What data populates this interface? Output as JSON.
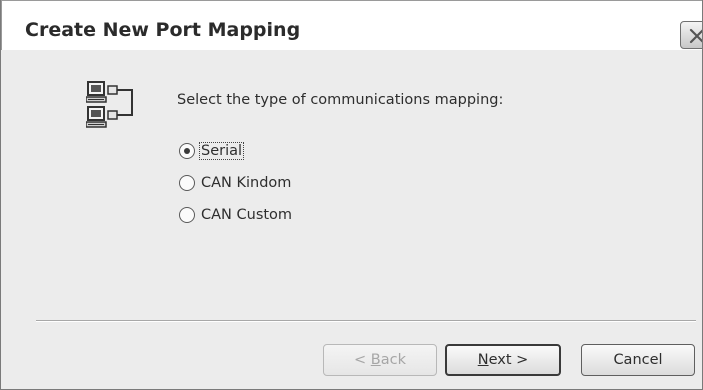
{
  "window": {
    "title": "Create New Port Mapping",
    "close_icon": "close-icon"
  },
  "content": {
    "icon": "network-mapping-icon",
    "prompt": "Select the type of communications mapping:",
    "options": [
      {
        "label": "Serial",
        "selected": true,
        "focused": true
      },
      {
        "label": "CAN Kindom",
        "selected": false,
        "focused": false
      },
      {
        "label": "CAN Custom",
        "selected": false,
        "focused": false
      }
    ]
  },
  "buttons": {
    "back": {
      "prefix": "< ",
      "mnemonic": "B",
      "rest": "ack",
      "enabled": false
    },
    "next": {
      "mnemonic": "N",
      "rest": "ext >",
      "enabled": true,
      "default": true
    },
    "cancel": {
      "label": "Cancel",
      "enabled": true
    }
  }
}
